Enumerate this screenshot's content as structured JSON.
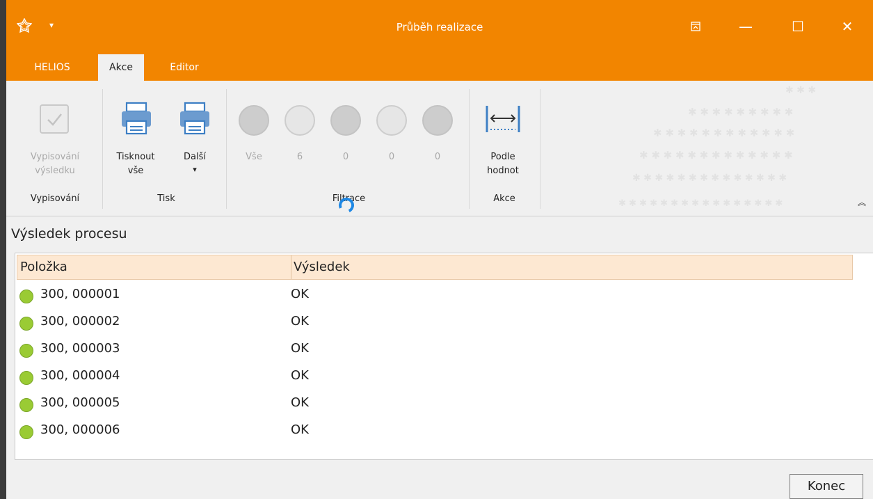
{
  "window": {
    "title": "Průběh realizace"
  },
  "titlebar_buttons": {
    "restore_icon": "ribbon-display-icon",
    "minimize": "—",
    "maximize": "☐",
    "close": "✕"
  },
  "tabs": [
    {
      "label": "HELIOS",
      "active": false
    },
    {
      "label": "Akce",
      "active": true
    },
    {
      "label": "Editor",
      "active": false
    }
  ],
  "ribbon": {
    "vypisovani": {
      "button_label_1": "Vypisování",
      "button_label_2": "výsledku",
      "group": "Vypisování"
    },
    "tisk": {
      "print_all_1": "Tisknout",
      "print_all_2": "vše",
      "more": "Další",
      "more_arrow": "▾",
      "group": "Tisk"
    },
    "filtrace": {
      "items": [
        {
          "label": "Vše",
          "style": "filled"
        },
        {
          "label": "6",
          "style": "outline"
        },
        {
          "label": "0",
          "style": "filled"
        },
        {
          "label": "0",
          "style": "outline"
        },
        {
          "label": "0",
          "style": "filled"
        }
      ],
      "group": "Filtrace"
    },
    "akce": {
      "button_label_1": "Podle",
      "button_label_2": "hodnot",
      "group": "Akce"
    },
    "collapse_glyph": "︽"
  },
  "panel": {
    "title": "Výsledek procesu",
    "columns": [
      "Položka",
      "Výsledek"
    ],
    "rows": [
      {
        "item": "300, 000001",
        "result": "OK"
      },
      {
        "item": "300, 000002",
        "result": "OK"
      },
      {
        "item": "300, 000003",
        "result": "OK"
      },
      {
        "item": "300, 000004",
        "result": "OK"
      },
      {
        "item": "300, 000005",
        "result": "OK"
      },
      {
        "item": "300, 000006",
        "result": "OK"
      }
    ]
  },
  "footer": {
    "close_button": "Konec"
  },
  "colors": {
    "accent": "#f28500",
    "status_ok": "#9acb34",
    "header_bg": "#fde8d2"
  }
}
